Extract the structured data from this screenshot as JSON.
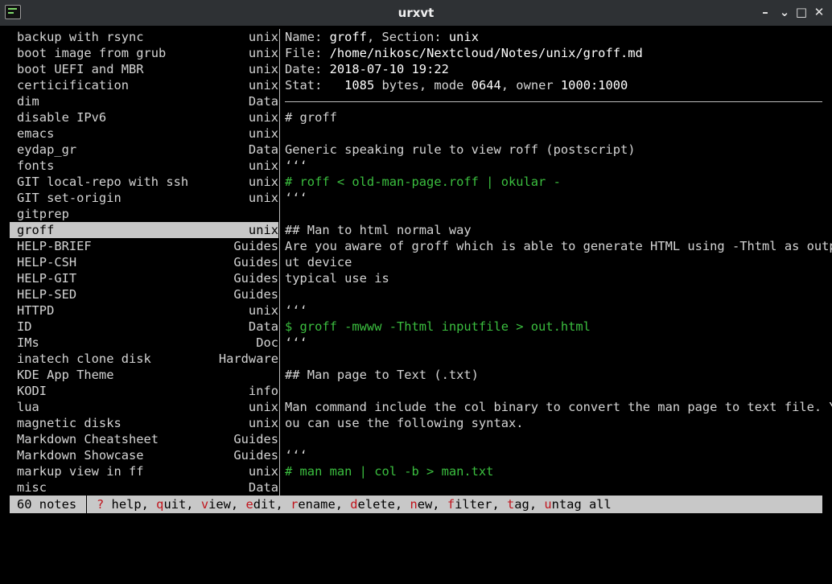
{
  "window": {
    "title": "urxvt"
  },
  "notes": [
    {
      "name": "backup with rsync",
      "tag": "unix"
    },
    {
      "name": "boot image from grub",
      "tag": "unix"
    },
    {
      "name": "boot UEFI and MBR",
      "tag": "unix"
    },
    {
      "name": "certicification",
      "tag": "unix"
    },
    {
      "name": "dim",
      "tag": "Data"
    },
    {
      "name": "disable IPv6",
      "tag": "unix"
    },
    {
      "name": "emacs",
      "tag": "unix"
    },
    {
      "name": "eydap_gr",
      "tag": "Data"
    },
    {
      "name": "fonts",
      "tag": "unix"
    },
    {
      "name": "GIT local-repo with ssh",
      "tag": "unix"
    },
    {
      "name": "GIT set-origin",
      "tag": "unix"
    },
    {
      "name": "gitprep",
      "tag": ""
    },
    {
      "name": "groff",
      "tag": "unix",
      "selected": true
    },
    {
      "name": "HELP-BRIEF",
      "tag": "Guides"
    },
    {
      "name": "HELP-CSH",
      "tag": "Guides"
    },
    {
      "name": "HELP-GIT",
      "tag": "Guides"
    },
    {
      "name": "HELP-SED",
      "tag": "Guides"
    },
    {
      "name": "HTTPD",
      "tag": "unix"
    },
    {
      "name": "ID",
      "tag": "Data"
    },
    {
      "name": "IMs",
      "tag": "Doc"
    },
    {
      "name": "inatech clone disk",
      "tag": "Hardware"
    },
    {
      "name": "KDE App Theme",
      "tag": ""
    },
    {
      "name": "KODI",
      "tag": "info"
    },
    {
      "name": "lua",
      "tag": "unix"
    },
    {
      "name": "magnetic disks",
      "tag": "unix"
    },
    {
      "name": "Markdown Cheatsheet",
      "tag": "Guides"
    },
    {
      "name": "Markdown Showcase",
      "tag": "Guides"
    },
    {
      "name": "markup view in ff",
      "tag": "unix"
    },
    {
      "name": "misc",
      "tag": "Data"
    }
  ],
  "preview": {
    "meta": {
      "name_label": "Name: ",
      "name_value": "groff",
      "section_label": ", Section: ",
      "section_value": "unix",
      "file_label": "File: ",
      "file_value": "/home/nikosc/Nextcloud/Notes/unix/groff.md",
      "date_label": "Date: ",
      "date_value": "2018-07-10 19:22",
      "stat_label": "Stat:   ",
      "stat_bytes": "1085",
      "stat_mid": " bytes, mode ",
      "stat_mode": "0644",
      "stat_owner_label": ", owner ",
      "stat_owner": "1000:1000"
    },
    "lines": [
      {
        "text": "# groff",
        "style": "normal"
      },
      {
        "text": "",
        "style": "normal"
      },
      {
        "text": "Generic speaking rule to view roff (postscript)",
        "style": "normal"
      },
      {
        "text": "‘‘‘",
        "style": "normal"
      },
      {
        "text": "# roff < old-man-page.roff | okular -",
        "style": "green"
      },
      {
        "text": "‘‘‘",
        "style": "normal"
      },
      {
        "text": "",
        "style": "normal"
      },
      {
        "text": "## Man to html normal way",
        "style": "normal"
      },
      {
        "text": "Are you aware of groff which is able to generate HTML using -Thtml as outp",
        "style": "normal"
      },
      {
        "text": "ut device",
        "style": "normal"
      },
      {
        "text": "typical use is",
        "style": "normal"
      },
      {
        "text": "",
        "style": "normal"
      },
      {
        "text": "‘‘‘",
        "style": "normal"
      },
      {
        "text": "$ groff -mwww -Thtml inputfile > out.html",
        "style": "green"
      },
      {
        "text": "‘‘‘",
        "style": "normal"
      },
      {
        "text": "",
        "style": "normal"
      },
      {
        "text": "## Man page to Text (.txt)",
        "style": "normal"
      },
      {
        "text": "",
        "style": "normal"
      },
      {
        "text": "Man command include the col binary to convert the man page to text file. Y",
        "style": "normal"
      },
      {
        "text": "ou can use the following syntax.",
        "style": "normal"
      },
      {
        "text": "",
        "style": "normal"
      },
      {
        "text": "‘‘‘",
        "style": "normal"
      },
      {
        "text": "# man man | col -b > man.txt",
        "style": "green"
      },
      {
        "text": "",
        "style": "normal"
      }
    ]
  },
  "status": {
    "count": "60 notes",
    "keys": [
      {
        "key": "?",
        "rest": " help"
      },
      {
        "key": "q",
        "rest": "uit"
      },
      {
        "key": "v",
        "rest": "iew"
      },
      {
        "key": "e",
        "rest": "dit"
      },
      {
        "key": "r",
        "rest": "ename"
      },
      {
        "key": "d",
        "rest": "elete"
      },
      {
        "key": "n",
        "rest": "ew"
      },
      {
        "key": "f",
        "rest": "ilter"
      },
      {
        "key": "t",
        "rest": "ag"
      },
      {
        "key": "u",
        "rest": "ntag all"
      }
    ]
  }
}
